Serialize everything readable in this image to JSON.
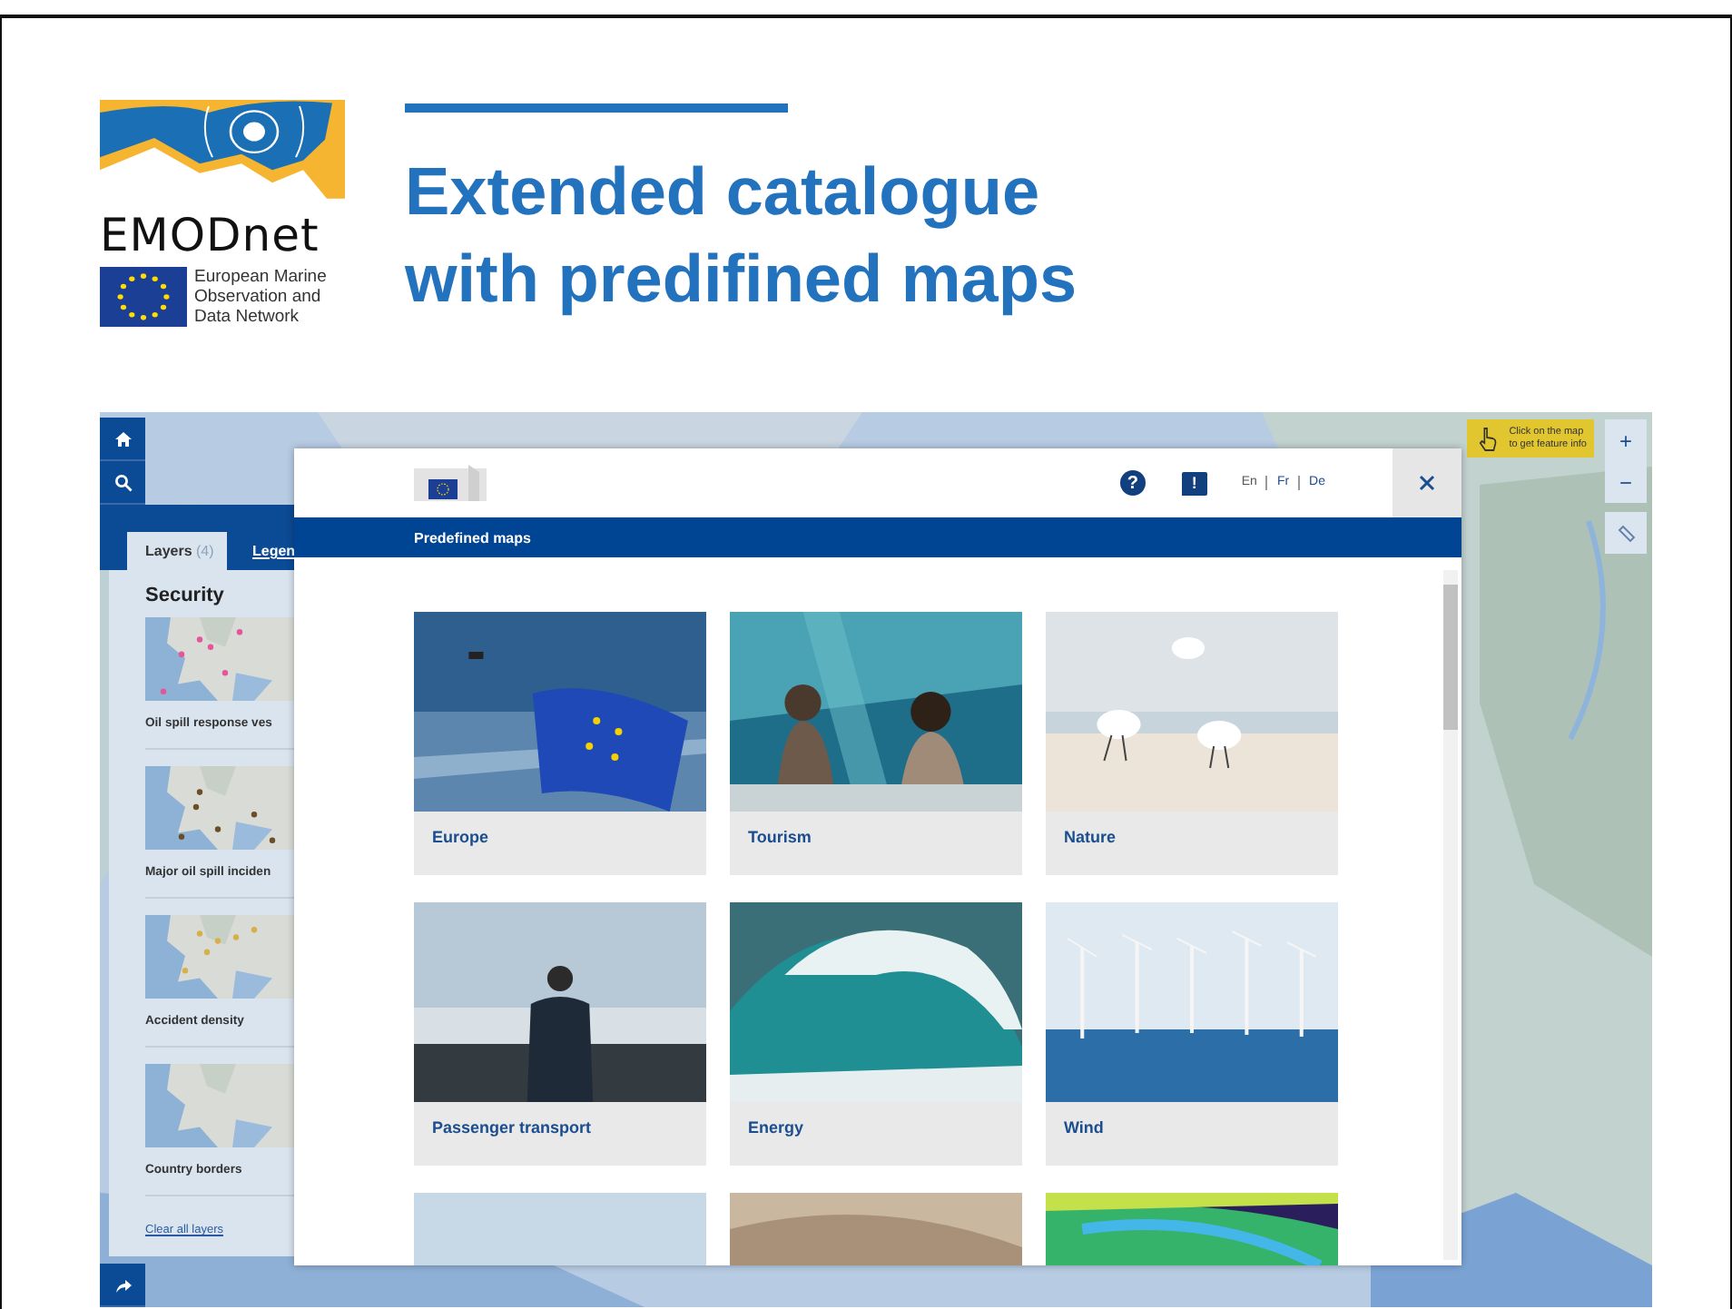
{
  "slide": {
    "title_lines": [
      "Extended catalogue",
      "with predifined maps"
    ]
  },
  "logo": {
    "name": "EMODnet",
    "tagline_lines": [
      "European Marine",
      "Observation and",
      "Data Network"
    ]
  },
  "app": {
    "sidebar": {
      "tabs": [
        {
          "label": "Layers",
          "count": "(4)",
          "selected": true
        },
        {
          "label": "Legen",
          "selected": false
        }
      ],
      "heading": "Security",
      "layers": [
        {
          "title": "Oil spill response ves"
        },
        {
          "title": "Major oil spill inciden"
        },
        {
          "title": "Accident density"
        },
        {
          "title": "Country borders"
        }
      ],
      "clear_link": "Clear all layers"
    },
    "tooltip": {
      "lines": [
        "Click on the map",
        "to get feature info"
      ]
    },
    "zoom": {
      "in": "+",
      "out": "−"
    },
    "modal": {
      "help": "?",
      "feedback": "!",
      "languages": [
        {
          "label": "En",
          "selected": true
        },
        {
          "label": "Fr",
          "selected": false
        },
        {
          "label": "De",
          "selected": false
        }
      ],
      "banner": "Predefined maps",
      "cards": [
        {
          "title": "Europe"
        },
        {
          "title": "Tourism"
        },
        {
          "title": "Nature"
        },
        {
          "title": "Passenger transport"
        },
        {
          "title": "Energy"
        },
        {
          "title": "Wind"
        },
        {
          "kind": "picture"
        },
        {
          "kind": "picture"
        },
        {
          "kind": "picture"
        }
      ]
    }
  }
}
